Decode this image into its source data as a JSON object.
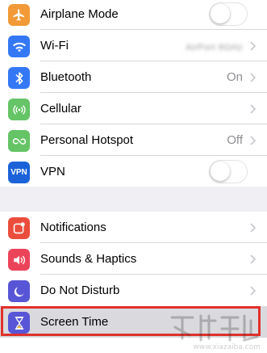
{
  "colors": {
    "airplane": "#f19a37",
    "wifi": "#3478f6",
    "bluetooth": "#3478f6",
    "cellular": "#65c466",
    "hotspot": "#65c466",
    "vpn": "#1b62d8",
    "notifications": "#eb4d3d",
    "sounds": "#eb445a",
    "dnd": "#5856d6",
    "screen_time": "#5856d6",
    "highlight": "#e0312a"
  },
  "section1": {
    "items": [
      {
        "label": "Airplane Mode",
        "icon": "airplane-icon",
        "toggle_on": false
      },
      {
        "label": "Wi-Fi",
        "icon": "wifi-icon",
        "value": "AirPort 8GHz"
      },
      {
        "label": "Bluetooth",
        "icon": "bluetooth-icon",
        "value": "On"
      },
      {
        "label": "Cellular",
        "icon": "cellular-icon"
      },
      {
        "label": "Personal Hotspot",
        "icon": "hotspot-icon",
        "value": "Off"
      },
      {
        "label": "VPN",
        "icon": "vpn-icon",
        "icon_text": "VPN",
        "toggle_on": false
      }
    ]
  },
  "section2": {
    "items": [
      {
        "label": "Notifications",
        "icon": "notifications-icon"
      },
      {
        "label": "Sounds & Haptics",
        "icon": "speaker-icon"
      },
      {
        "label": "Do Not Disturb",
        "icon": "moon-icon"
      },
      {
        "label": "Screen Time",
        "icon": "hourglass-icon",
        "highlighted": true
      }
    ]
  }
}
